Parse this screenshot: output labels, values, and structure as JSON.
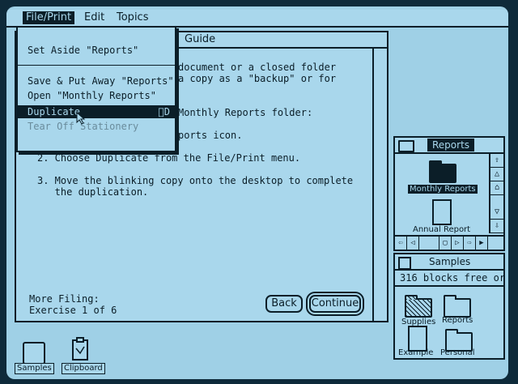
{
  "menubar": {
    "items": [
      "File/Print",
      "Edit",
      "Topics"
    ]
  },
  "doc_window": {
    "title_fragment": "Guide",
    "lines": [
      "document or a closed folder",
      "a copy as a \"backup\" or for",
      "Monthly Reports folder:",
      "ports icon.",
      "2. Choose Duplicate from the File/Print menu.",
      "3. Move the blinking copy onto the desktop to complete",
      "   the duplication."
    ],
    "footer_title": "More Filing:",
    "footer_sub": "Exercise 1 of 6",
    "back_label": "Back",
    "continue_label": "Continue"
  },
  "file_menu": {
    "items": [
      {
        "label": "Set Aside \"Reports\"",
        "state": "normal"
      },
      {
        "label": "Save & Put Away \"Reports\"",
        "state": "normal"
      },
      {
        "label": "Open \"Monthly Reports\"",
        "state": "normal"
      },
      {
        "label": "Duplicate",
        "state": "highlighted",
        "shortcut": "D"
      },
      {
        "label": "Tear Off Stationery",
        "state": "disabled"
      }
    ]
  },
  "reports_window": {
    "title": "Reports",
    "items": [
      {
        "label": "Monthly Reports",
        "selected": true
      },
      {
        "label": "Annual Report",
        "selected": false
      }
    ]
  },
  "samples_window": {
    "title": "Samples",
    "info": "316 blocks free or",
    "items": [
      "Supplies",
      "Reports",
      "Example",
      "Personal"
    ]
  },
  "desktop": {
    "icons": [
      "Samples",
      "Clipboard"
    ]
  },
  "colors": {
    "ink": "#0b1e28",
    "paper": "#a9d7ec",
    "desktop": "#9fd0e6"
  }
}
